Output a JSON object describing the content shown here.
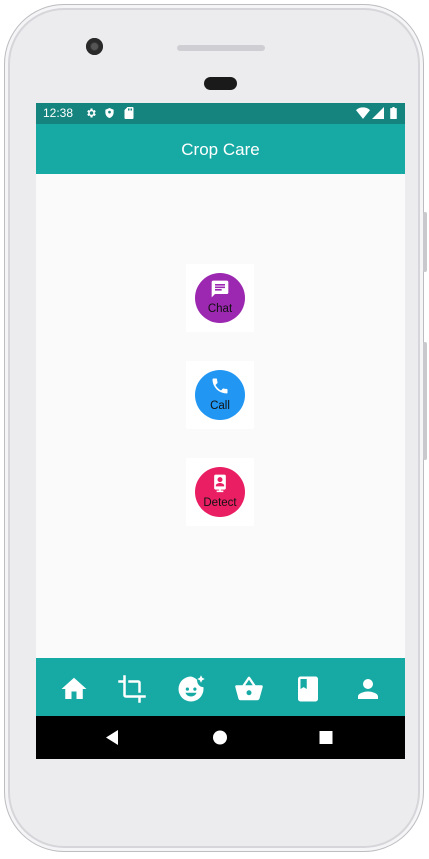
{
  "status_bar": {
    "time": "12:38",
    "icons": [
      "gear-icon",
      "shield-icon",
      "sd-card-icon",
      "wifi-icon",
      "signal-icon",
      "battery-icon"
    ]
  },
  "app_bar": {
    "title": "Crop Care"
  },
  "actions": [
    {
      "label": "Chat",
      "icon": "chat-icon",
      "color": "#9c27b0"
    },
    {
      "label": "Call",
      "icon": "phone-icon",
      "color": "#2196f3"
    },
    {
      "label": "Detect",
      "icon": "detect-icon",
      "color": "#e91e63"
    }
  ],
  "bottom_nav": {
    "items": [
      "home-icon",
      "crop-icon",
      "face-icon",
      "basket-icon",
      "book-icon",
      "person-icon"
    ]
  },
  "system_nav": {
    "items": [
      "back-icon",
      "home-circle-icon",
      "recents-icon"
    ]
  },
  "colors": {
    "status_bar": "#16847e",
    "app_bar": "#17aaa4",
    "background": "#fafafa"
  }
}
